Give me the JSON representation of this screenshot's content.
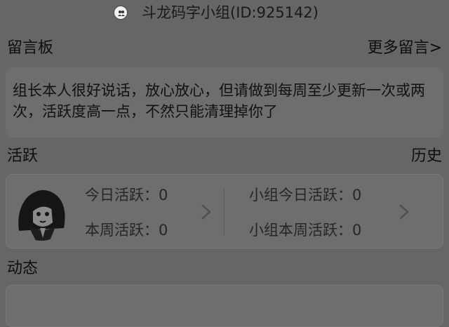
{
  "header": {
    "title": "斗龙码字小组(ID:925142)",
    "icon": "group-icon"
  },
  "message_board": {
    "label": "留言板",
    "more_link": "更多留言>",
    "message": "组长本人很好说话，放心放心，但请做到每周至少更新一次或两次，活跃度高一点，不然只能清理掉你了"
  },
  "activity": {
    "label": "活跃",
    "history_link": "历史",
    "personal": {
      "today_label": "今日活跃：",
      "today_value": "0",
      "week_label": "本周活跃：",
      "week_value": "0"
    },
    "group": {
      "today_label": "小组今日活跃：",
      "today_value": "0",
      "week_label": "小组本周活跃：",
      "week_value": "0"
    }
  },
  "dynamics": {
    "label": "动态"
  },
  "colors": {
    "background": "#666666",
    "card": "#6e6e6e"
  }
}
